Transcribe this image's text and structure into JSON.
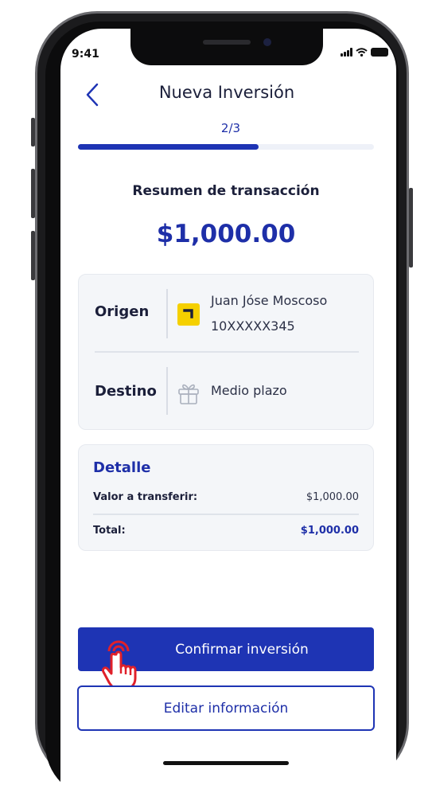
{
  "status_bar": {
    "time": "9:41",
    "icons": [
      "signal-icon",
      "wifi-icon",
      "battery-icon"
    ]
  },
  "header": {
    "title": "Nueva Inversión",
    "step": "2/3",
    "progress_fraction": 0.61
  },
  "summary": {
    "title": "Resumen de transacción",
    "amount": "$1,000.00"
  },
  "origin": {
    "label": "Origen",
    "name": "Juan Jóse Moscoso",
    "account": "10XXXXX345",
    "icon": "bank-logo-icon"
  },
  "destination": {
    "label": "Destino",
    "name": "Medio plazo",
    "icon": "gift-icon"
  },
  "detail": {
    "title": "Detalle",
    "rows": [
      {
        "label": "Valor a transferir:",
        "value": "$1,000.00"
      },
      {
        "label": "Total:",
        "value": "$1,000.00"
      }
    ]
  },
  "actions": {
    "confirm_label": "Confirmar inversión",
    "edit_label": "Editar información"
  },
  "colors": {
    "primary": "#1e34b4",
    "accent_yellow": "#f5d000",
    "card_bg": "#f4f6f9"
  }
}
